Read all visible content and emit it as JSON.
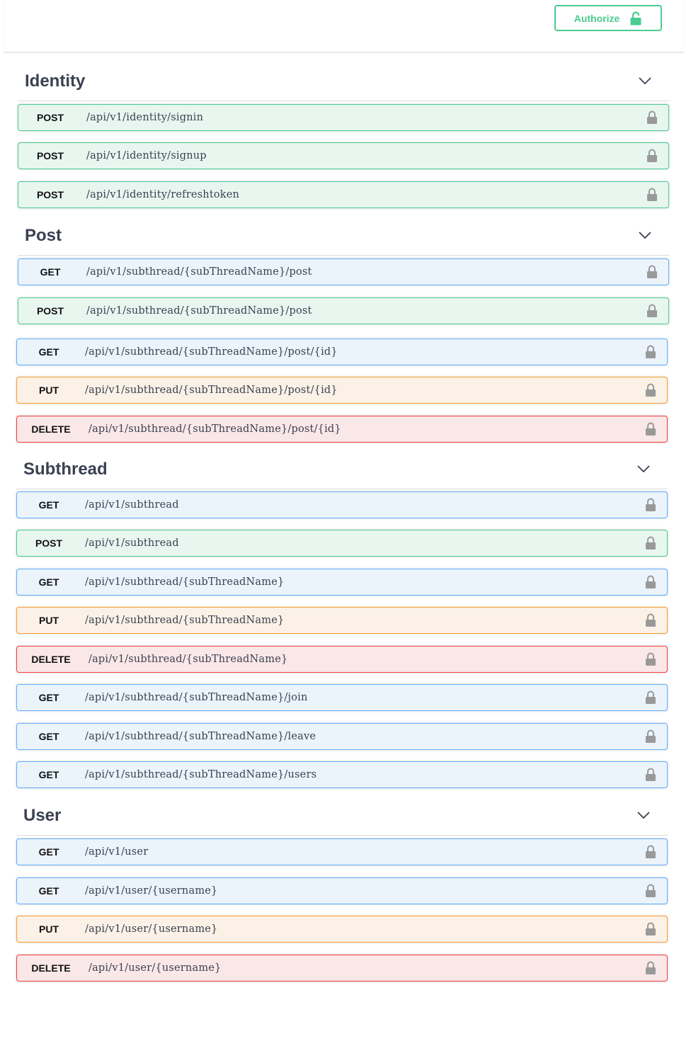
{
  "topbar": {
    "authorize_label": "Authorize",
    "authorize_icon": "unlocked-padlock-icon"
  },
  "colors": {
    "get": "#61affe",
    "post": "#49cc90",
    "put": "#fca130",
    "delete": "#f93e3e"
  },
  "sections": [
    {
      "title": "Identity",
      "operations": [
        {
          "method": "POST",
          "path": "/api/v1/identity/signin"
        },
        {
          "method": "POST",
          "path": "/api/v1/identity/signup"
        },
        {
          "method": "POST",
          "path": "/api/v1/identity/refreshtoken"
        }
      ]
    },
    {
      "title": "Post",
      "operations": [
        {
          "method": "GET",
          "path": "/api/v1/subthread/{subThreadName}/post"
        },
        {
          "method": "POST",
          "path": "/api/v1/subthread/{subThreadName}/post"
        },
        {
          "method": "GET",
          "path": "/api/v1/subthread/{subThreadName}/post/{id}"
        },
        {
          "method": "PUT",
          "path": "/api/v1/subthread/{subThreadName}/post/{id}"
        },
        {
          "method": "DELETE",
          "path": "/api/v1/subthread/{subThreadName}/post/{id}"
        }
      ]
    },
    {
      "title": "Subthread",
      "operations": [
        {
          "method": "GET",
          "path": "/api/v1/subthread"
        },
        {
          "method": "POST",
          "path": "/api/v1/subthread"
        },
        {
          "method": "GET",
          "path": "/api/v1/subthread/{subThreadName}"
        },
        {
          "method": "PUT",
          "path": "/api/v1/subthread/{subThreadName}"
        },
        {
          "method": "DELETE",
          "path": "/api/v1/subthread/{subThreadName}"
        },
        {
          "method": "GET",
          "path": "/api/v1/subthread/{subThreadName}/join"
        },
        {
          "method": "GET",
          "path": "/api/v1/subthread/{subThreadName}/leave"
        },
        {
          "method": "GET",
          "path": "/api/v1/subthread/{subThreadName}/users"
        }
      ]
    },
    {
      "title": "User",
      "operations": [
        {
          "method": "GET",
          "path": "/api/v1/user"
        },
        {
          "method": "GET",
          "path": "/api/v1/user/{username}"
        },
        {
          "method": "PUT",
          "path": "/api/v1/user/{username}"
        },
        {
          "method": "DELETE",
          "path": "/api/v1/user/{username}"
        }
      ]
    }
  ]
}
